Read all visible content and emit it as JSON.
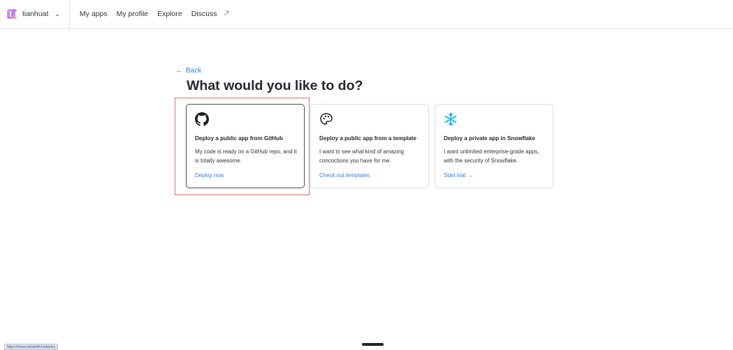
{
  "nav": {
    "workspace": "tianhuat",
    "links": [
      "My apps",
      "My profile",
      "Explore",
      "Discuss"
    ]
  },
  "back_label": "Back",
  "title": "What would you like to do?",
  "cards": [
    {
      "title": "Deploy a public app from GitHub",
      "desc": "My code is ready on a GitHub repo, and it is totally awesome.",
      "link": "Deploy now",
      "icon": "github-icon"
    },
    {
      "title": "Deploy a public app from a template",
      "desc": "I want to see what kind of amazing concoctions you have for me.",
      "link": "Check out templates",
      "icon": "palette-icon"
    },
    {
      "title": "Deploy a private app in Snowflake",
      "desc": "I want unlimited enterprise-grade apps, with the security of Snowflake.",
      "link": "Start trial →",
      "icon": "snowflake-icon"
    }
  ],
  "status_url": "https://share.streamlit.io/deploy",
  "colors": {
    "link": "#2f80ed",
    "highlight": "#e46a6a",
    "snowflake": "#29b5e8"
  }
}
